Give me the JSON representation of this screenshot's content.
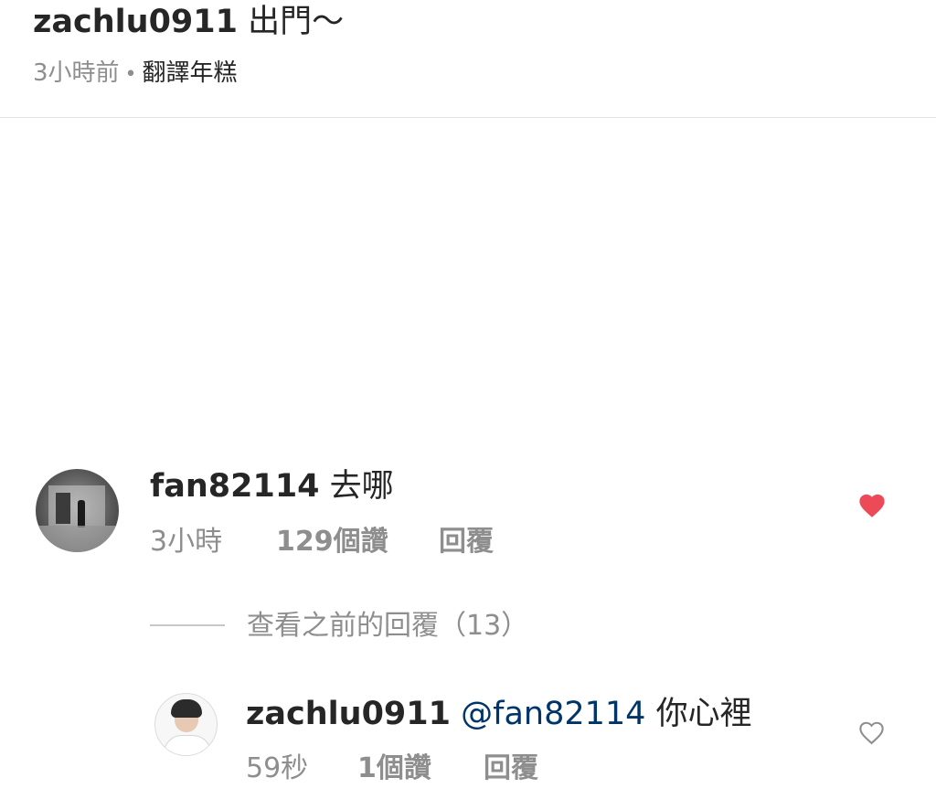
{
  "post": {
    "username": "zachlu0911",
    "caption": "出門～",
    "time": "3小時前",
    "separator": "•",
    "translate_label": "翻譯年糕"
  },
  "comment": {
    "username": "fan82114",
    "text": "去哪",
    "time": "3小時",
    "likes": "129個讚",
    "reply_label": "回覆",
    "liked": true,
    "like_color": "#ed4956"
  },
  "view_replies": {
    "label": "查看之前的回覆（13）"
  },
  "reply": {
    "username": "zachlu0911",
    "mention": "@fan82114",
    "text": "你心裡",
    "time": "59秒",
    "likes": "1個讚",
    "reply_label": "回覆",
    "liked": false
  },
  "colors": {
    "text": "#262626",
    "secondary": "#8e8e8e",
    "mention": "#003569"
  },
  "icons": {
    "comment_like": "heart-filled-icon",
    "reply_like": "heart-outline-icon"
  }
}
